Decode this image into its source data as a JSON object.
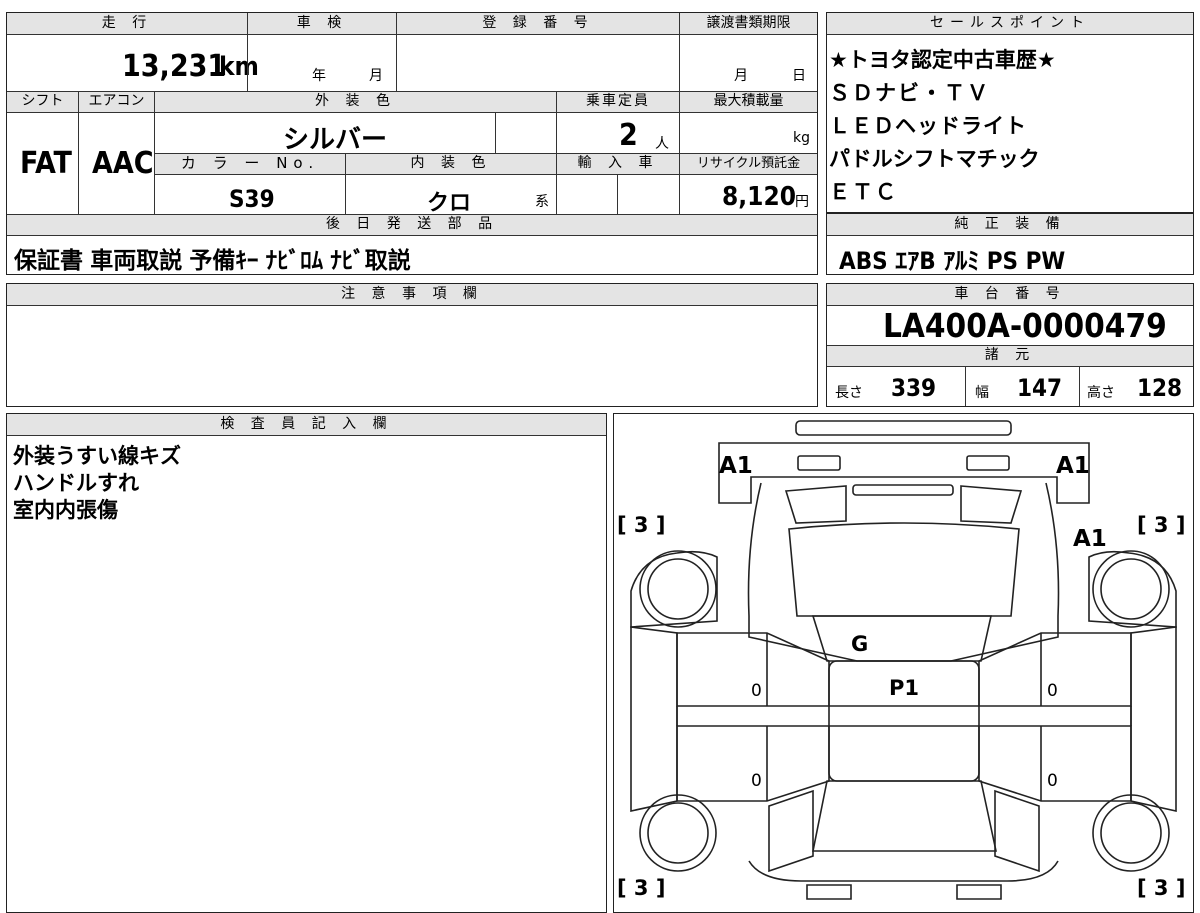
{
  "top": {
    "mileage_header": "走 行",
    "mileage_value": "13,231",
    "mileage_unit": "km",
    "inspection_header": "車 検",
    "inspection_year": "年",
    "inspection_month": "月",
    "registration_header": "登 録 番 号",
    "transfer_header": "譲渡書類期限",
    "transfer_month": "月",
    "transfer_day": "日",
    "shift_header": "シフト",
    "shift_value": "FAT",
    "aircon_header": "エアコン",
    "aircon_value": "AAC",
    "exterior_header": "外 装 色",
    "exterior_value": "シルバー",
    "capacity_header": "乗車定員",
    "capacity_value": "2",
    "capacity_unit": "人",
    "maxload_header": "最大積載量",
    "maxload_unit": "kg",
    "color_no_header": "カ ラ ー No.",
    "color_no_value": "S39",
    "interior_header": "内 装 色",
    "interior_value": "クロ",
    "interior_suffix": "系",
    "import_header": "輸 入 車",
    "recycle_header": "リサイクル預託金",
    "recycle_value": "8,120",
    "recycle_unit": "円",
    "parts_header": "後 日 発 送 部 品",
    "parts_value": "保証書 車両取説 予備ｷｰ ﾅﾋﾞﾛﾑ ﾅﾋﾞ取説",
    "caution_header": "注 意 事 項 欄"
  },
  "sales": {
    "header": "セールスポイント",
    "lines": [
      "★トヨタ認定中古車歴★",
      "ＳＤナビ・ＴＶ",
      "ＬＥＤヘッドライト",
      "パドルシフトマチック",
      "ＥＴＣ"
    ]
  },
  "equipment": {
    "header": "純 正 装 備",
    "value": "ABS ｴｱB ｱﾙﾐ PS PW"
  },
  "chassis": {
    "header": "車 台 番 号",
    "value": "LA400A-0000479"
  },
  "specs": {
    "header": "諸 元",
    "length_label": "長さ",
    "length_value": "339",
    "width_label": "幅",
    "width_value": "147",
    "height_label": "高さ",
    "height_value": "128"
  },
  "inspector": {
    "header": "検 査 員 記 入 欄",
    "lines": [
      "外装うすい線キズ",
      "ハンドルすれ",
      "室内内張傷"
    ]
  },
  "diagram": {
    "a1_left": "A1",
    "a1_right": "A1",
    "a1_side": "A1",
    "tire_tl": "[ 3 ]",
    "tire_tr": "[ 3 ]",
    "tire_bl": "[ 3 ]",
    "tire_br": "[ 3 ]",
    "glass_mark": "G",
    "floor_mark": "P1",
    "door_fl": "0",
    "door_fr": "0",
    "door_rl": "0",
    "door_rr": "0"
  }
}
